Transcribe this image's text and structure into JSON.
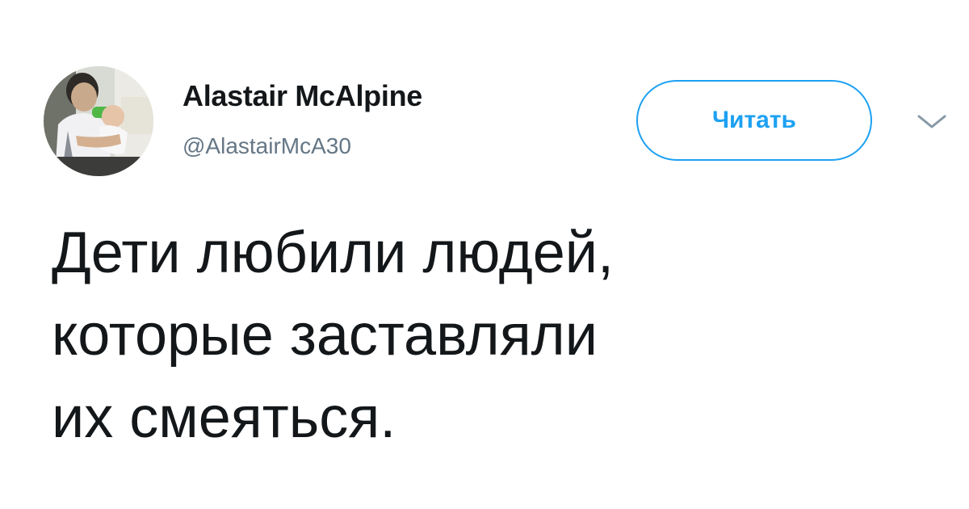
{
  "author": {
    "display_name": "Alastair McAlpine",
    "handle": "@AlastairMcA30",
    "avatar_icon": "profile-photo"
  },
  "follow_button": {
    "label": "Читать",
    "accent_color": "#1da1f2"
  },
  "menu": {
    "icon": "chevron-down-icon"
  },
  "tweet": {
    "lines": [
      "Дети любили людей,",
      "которые заставляли",
      "их смеяться."
    ]
  }
}
